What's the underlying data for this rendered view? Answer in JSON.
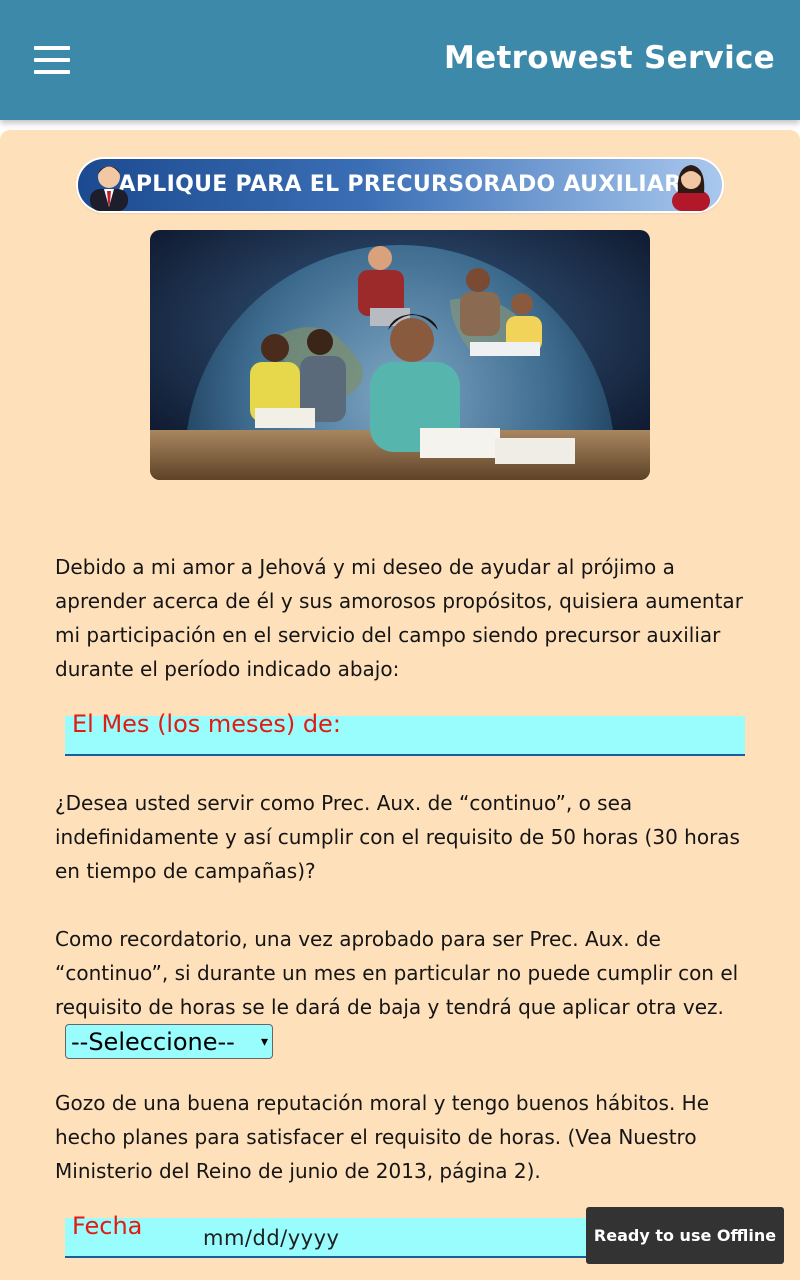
{
  "app": {
    "title": "Metrowest Service"
  },
  "banner": {
    "text": "APLIQUE PARA EL PRECURSORADO AUXILIAR"
  },
  "form": {
    "intro": "Debido a mi amor a Jehová y mi deseo de ayudar al prójimo a aprender acerca de él y sus amorosos propósitos, quisiera aumentar mi participación en el servicio del campo siendo precursor auxiliar durante el período indicado abajo:",
    "months_label": "El Mes (los meses) de:",
    "continuous_question": "¿Desea usted servir como Prec. Aux. de “continuo”, o sea indefinidamente y así cumplir con el requisito de 50 horas (30 horas en tiempo de campañas)?",
    "reminder": "Como recordatorio, una vez aprobado para ser Prec. Aux. de “continuo”, si durante un mes en particular no puede cumplir con el requisito de horas se le dará de baja y tendrá que aplicar otra vez.",
    "select_value": "--Seleccione--",
    "declaration": "Gozo de una buena reputación moral y tengo buenos hábitos. He hecho planes para satisfacer el requisito de horas. (Vea Nuestro Ministerio del Reino de junio de 2013, página 2).",
    "date_label": "Fecha",
    "date_placeholder": "mm/dd/yyyy"
  },
  "toast": {
    "text": "Ready to use Offline"
  },
  "colors": {
    "header": "#3d89a9",
    "card": "#fee0bb",
    "field": "#99fcfd",
    "label_red": "#e31b10"
  }
}
